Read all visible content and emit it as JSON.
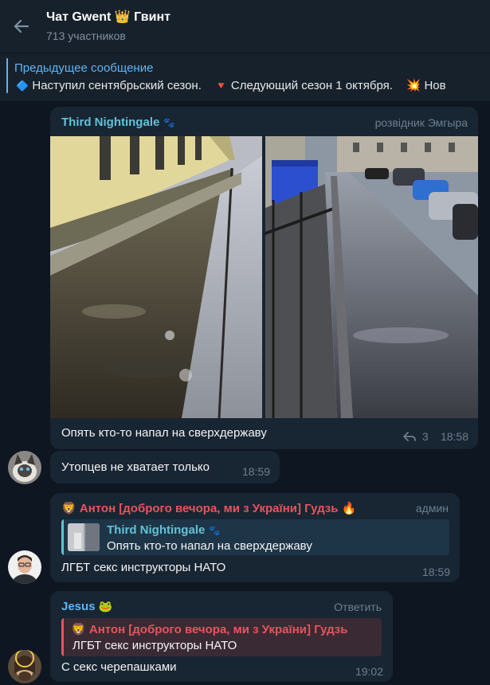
{
  "header": {
    "title": "Чат Gwent 👑 Гвинт",
    "subtitle": "713 участников"
  },
  "pinned": {
    "label": "Предыдущее сообщение",
    "icon1": "🔷",
    "text1": "Наступил сентябрьский сезон.",
    "icon2": "🔻",
    "text2": "Следующий сезон 1 октября.",
    "icon3": "💥",
    "text3": "Нов"
  },
  "messages": [
    {
      "author": "Third Nightingale",
      "author_emoji": "🐾",
      "rank": "розвідник Эмгыра",
      "text": "Опять кто-то напал на сверхдержаву",
      "replies": "3",
      "time": "18:58"
    },
    {
      "text": "Утопцев не хватает только",
      "time": "18:59"
    },
    {
      "author_prefix": "🦁",
      "author": "Антон [доброго вечора, ми з України] Гудзь",
      "author_suffix": "🔥",
      "rank": "админ",
      "reply_author": "Third Nightingale",
      "reply_author_emoji": "🐾",
      "reply_text": "Опять кто-то напал на сверхдержаву",
      "text": "ЛГБТ секс инструкторы НАТО",
      "time": "18:59"
    },
    {
      "author": "Jesus",
      "author_emoji": "🐸",
      "action": "Ответить",
      "reply_prefix": "🦁",
      "reply_author": "Антон [доброго вечора, ми з України] Гудзь",
      "reply_text": "ЛГБТ секс инструкторы НАТО",
      "text": "С секс черепашками",
      "time": "19:02"
    }
  ],
  "colors": {
    "background": "#0e1621",
    "header": "#17212b",
    "bubble": "#182533",
    "accent": "#5eb5f7",
    "name_nightingale": "#62c2d6",
    "name_anton": "#e8545d",
    "name_jesus": "#5eb5f7"
  },
  "icons": {
    "back": "arrow-left-icon",
    "reply_count": "reply-arrow-icon"
  }
}
